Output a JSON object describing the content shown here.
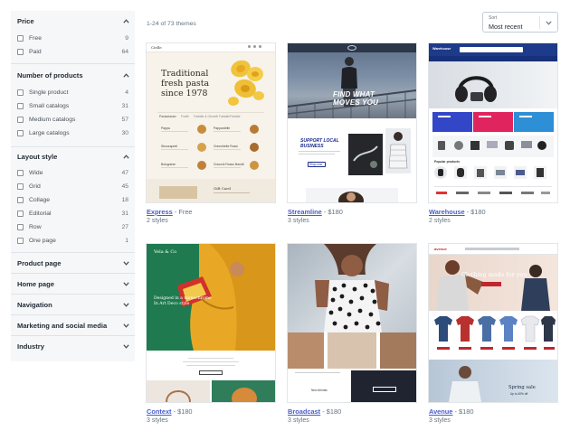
{
  "filters": {
    "sections": [
      {
        "title": "Price",
        "expanded": true,
        "options": [
          {
            "label": "Free",
            "count": "9"
          },
          {
            "label": "Paid",
            "count": "64"
          }
        ]
      },
      {
        "title": "Number of products",
        "expanded": true,
        "options": [
          {
            "label": "Single product",
            "count": "4"
          },
          {
            "label": "Small catalogs",
            "count": "31"
          },
          {
            "label": "Medium catalogs",
            "count": "57"
          },
          {
            "label": "Large catalogs",
            "count": "30"
          }
        ]
      },
      {
        "title": "Layout style",
        "expanded": true,
        "options": [
          {
            "label": "Wide",
            "count": "47"
          },
          {
            "label": "Grid",
            "count": "45"
          },
          {
            "label": "Collage",
            "count": "18"
          },
          {
            "label": "Editorial",
            "count": "31"
          },
          {
            "label": "Row",
            "count": "27"
          },
          {
            "label": "One page",
            "count": "1"
          }
        ]
      },
      {
        "title": "Product page",
        "expanded": false,
        "options": []
      },
      {
        "title": "Home page",
        "expanded": false,
        "options": []
      },
      {
        "title": "Navigation",
        "expanded": false,
        "options": []
      },
      {
        "title": "Marketing and social media",
        "expanded": false,
        "options": []
      },
      {
        "title": "Industry",
        "expanded": false,
        "options": []
      }
    ]
  },
  "results_text": "1-24 of 73 themes",
  "sort": {
    "label": "Sort",
    "value": "Most recent"
  },
  "themes": [
    {
      "name": "Express",
      "price": "Free",
      "styles": "2 styles",
      "preview": {
        "brand": "Cielle",
        "headline": [
          "Traditional",
          "fresh pasta",
          "since 1978"
        ],
        "tabs": [
          "Pastaclassic",
          "Fusilli",
          "Farfalle & Gemelli",
          "Farfalle/Farfalle"
        ],
        "items": [
          "Pappa",
          "Pappardelle",
          "Strozzapreti",
          "Orecchiette Rossi",
          "Bolognese",
          "Gnocchi Rosso Bandit"
        ],
        "footer": "Gift Card"
      }
    },
    {
      "name": "Streamline",
      "price": "$180",
      "styles": "3 styles",
      "preview": {
        "hero": [
          "FIND WHAT",
          "MOVES YOU"
        ],
        "section": [
          "SUPPORT LOCAL",
          "BUSINESS"
        ],
        "button": "Shop now"
      }
    },
    {
      "name": "Warehouse",
      "price": "$180",
      "styles": "2 styles",
      "preview": {
        "brand": "Warehouse",
        "section": "Popular products"
      }
    },
    {
      "name": "Context",
      "price": "$180",
      "styles": "3 styles",
      "preview": {
        "brand": "Vela & Co",
        "headline": [
          "Designed in a monochrome",
          "In Art Deco style"
        ]
      }
    },
    {
      "name": "Broadcast",
      "price": "$180",
      "styles": "3 styles",
      "preview": {
        "label": "New Arrivals"
      }
    },
    {
      "name": "Avenue",
      "price": "$180",
      "styles": "3 styles",
      "preview": {
        "brand": "avenue",
        "hero": "Clothing made for you",
        "promo": "Spring sale",
        "promo_sub": "Up to 40% off"
      }
    }
  ],
  "colors": {
    "link": "#4a5dc8",
    "sidebar_bg": "#f6f7f8",
    "muted": "#637381"
  }
}
